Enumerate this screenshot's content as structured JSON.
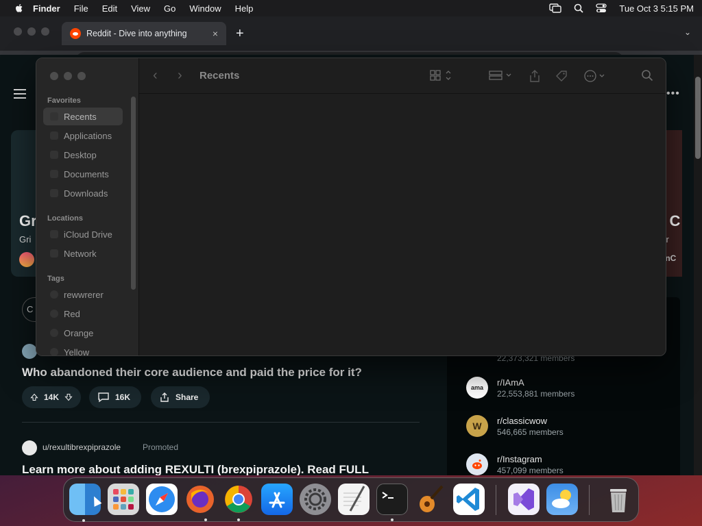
{
  "menubar": {
    "app": "Finder",
    "items": [
      "File",
      "Edit",
      "View",
      "Go",
      "Window",
      "Help"
    ],
    "clock": "Tue Oct 3  5:15 PM"
  },
  "browser": {
    "tab_title": "Reddit - Dive into anything",
    "tab_close": "×",
    "new_tab": "+"
  },
  "reddit": {
    "hero_left_title": "Gr",
    "hero_left_sub": "Gri",
    "hero_right_title": "n C",
    "hero_right_sub": "ber",
    "hero_right_sub2": "eanC",
    "post_title": "Who abandoned their core audience and paid the price for it?",
    "upvotes": "14K",
    "comments": "16K",
    "share": "Share",
    "ad_user": "u/rexultibrexpiprazole",
    "ad_promoted": "Promoted",
    "ad_title": "Learn more about adding REXULTI (brexpiprazole). Read FULL",
    "partial_members": "22,373,321 members",
    "communities": [
      {
        "name": "r/IAmA",
        "members": "22,553,881 members",
        "icon_text": "ama",
        "color": "#ffffff"
      },
      {
        "name": "r/classicwow",
        "members": "546,665 members",
        "icon_text": "W",
        "color": "#c8a34a"
      },
      {
        "name": "r/Instagram",
        "members": "457,099 members",
        "icon_text": "",
        "color": "#dfe6f0"
      }
    ]
  },
  "finder": {
    "title": "Recents",
    "favorites_heading": "Favorites",
    "favorites": [
      "Recents",
      "Applications",
      "Desktop",
      "Documents",
      "Downloads"
    ],
    "locations_heading": "Locations",
    "locations": [
      "iCloud Drive",
      "Network"
    ],
    "tags_heading": "Tags",
    "tags": [
      "rewwrerer",
      "Red",
      "Orange",
      "Yellow"
    ]
  },
  "dock": {
    "apps": [
      {
        "name": "finder",
        "color": "#3a8fd8"
      },
      {
        "name": "launchpad",
        "color": "#d9d9d9"
      },
      {
        "name": "safari",
        "color": "#2d8cf0"
      },
      {
        "name": "firefox",
        "color": "#e8632b"
      },
      {
        "name": "chrome",
        "color": "#f2f2f2"
      },
      {
        "name": "app-store",
        "color": "#1a8cff"
      },
      {
        "name": "system-settings",
        "color": "#8e8e93"
      },
      {
        "name": "textedit",
        "color": "#f4f4f4"
      },
      {
        "name": "terminal",
        "color": "#1c1c1c"
      },
      {
        "name": "garageband",
        "color": "#e38a2a"
      },
      {
        "name": "vscode",
        "color": "#1f8ad6"
      },
      {
        "name": "visual-studio",
        "color": "#f3f0fa"
      },
      {
        "name": "weather",
        "color": "#3d8ee6"
      },
      {
        "name": "trash",
        "color": "#c9c9c9"
      }
    ]
  }
}
